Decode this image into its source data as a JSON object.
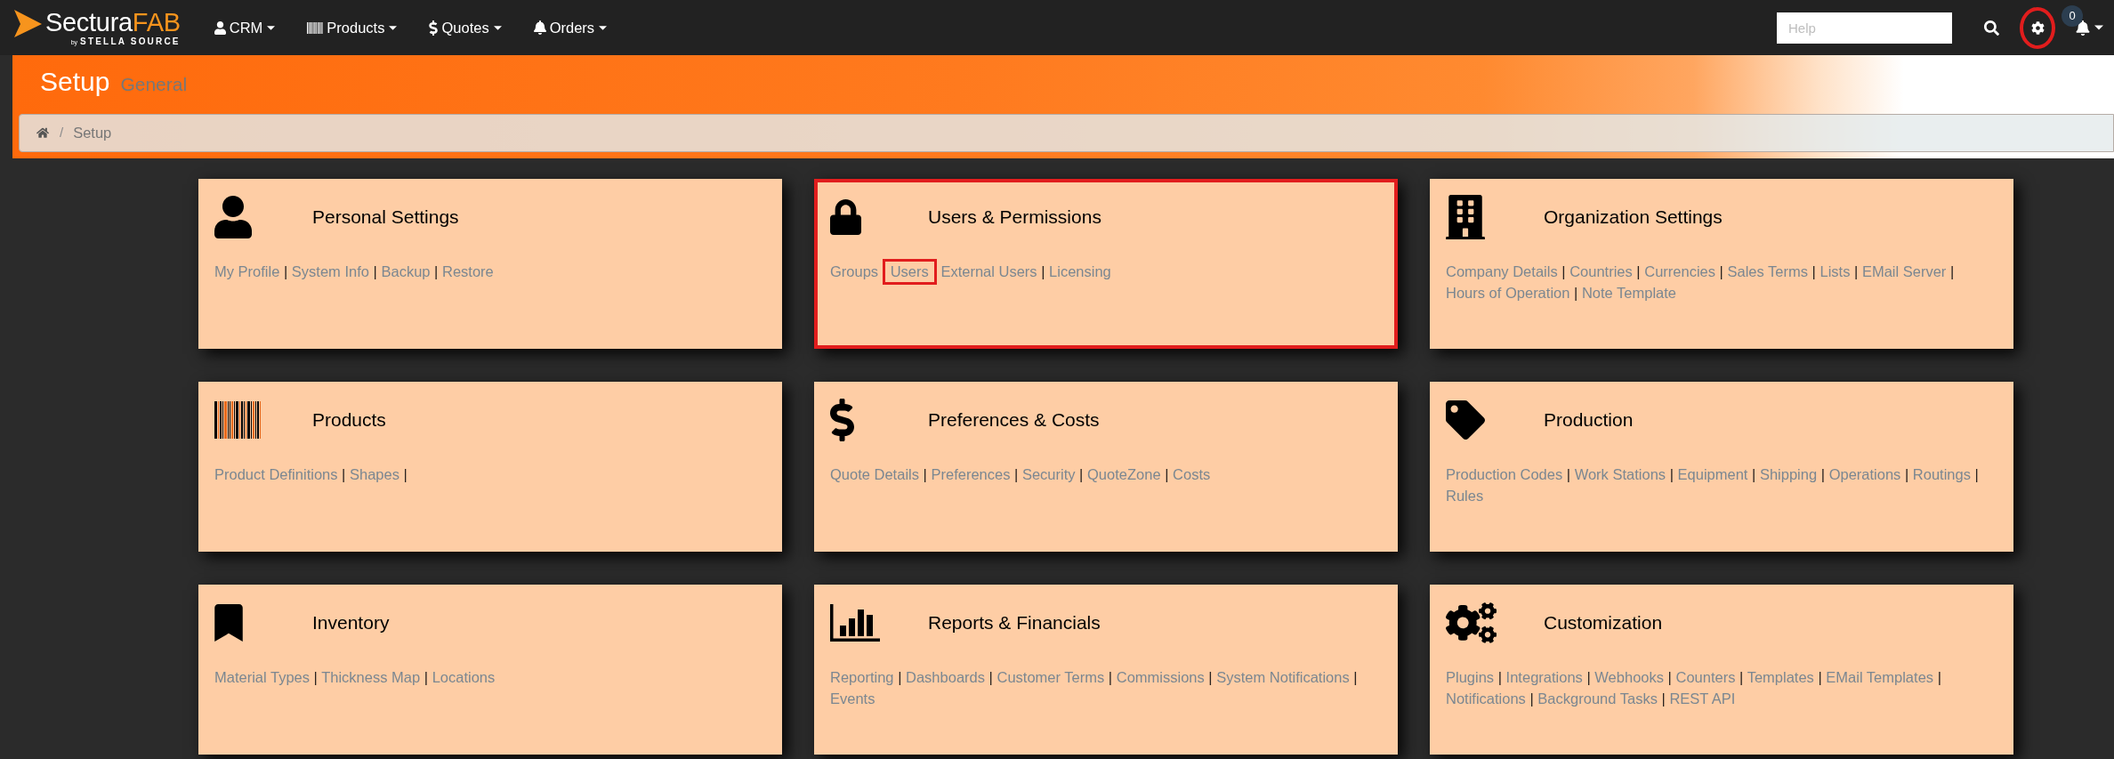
{
  "navbar": {
    "logo": {
      "name": "Sectura",
      "accent": "FAB",
      "tagline_prefix": "by",
      "tagline": "STELLA SOURCE"
    },
    "menus": [
      {
        "label": "CRM"
      },
      {
        "label": "Products"
      },
      {
        "label": "Quotes"
      },
      {
        "label": "Orders"
      }
    ],
    "help_search": {
      "placeholder": "Help"
    },
    "settings": {
      "highlighted": true
    },
    "notifications": {
      "count": "0"
    }
  },
  "page_header": {
    "title": "Setup",
    "subtitle": "General"
  },
  "breadcrumb": {
    "separator": "/",
    "items": [
      {
        "label": "Setup"
      }
    ]
  },
  "sections": [
    {
      "title": "Personal Settings",
      "highlighted": false,
      "links": [
        {
          "label": "My Profile",
          "highlighted": false,
          "separator": "|"
        },
        {
          "label": "System Info",
          "highlighted": false,
          "separator": "|"
        },
        {
          "label": "Backup",
          "highlighted": false,
          "separator": "|"
        },
        {
          "label": "Restore",
          "highlighted": false
        }
      ]
    },
    {
      "title": "Users & Permissions",
      "highlighted": true,
      "links": [
        {
          "label": "Groups",
          "highlighted": false
        },
        {
          "label": "Users",
          "highlighted": true
        },
        {
          "label": "External Users",
          "highlighted": false,
          "separator": "|"
        },
        {
          "label": "Licensing",
          "highlighted": false
        }
      ]
    },
    {
      "title": "Organization Settings",
      "highlighted": false,
      "links": [
        {
          "label": "Company Details",
          "highlighted": false,
          "separator": "|"
        },
        {
          "label": "Countries",
          "highlighted": false,
          "separator": "|"
        },
        {
          "label": "Currencies",
          "highlighted": false,
          "separator": "|"
        },
        {
          "label": "Sales Terms",
          "highlighted": false,
          "separator": "|"
        },
        {
          "label": "Lists",
          "highlighted": false,
          "separator": "|"
        },
        {
          "label": "EMail Server",
          "highlighted": false,
          "separator": "|"
        },
        {
          "label": "Hours of Operation",
          "highlighted": false,
          "separator": "|"
        },
        {
          "label": "Note Template",
          "highlighted": false
        }
      ]
    },
    {
      "title": "Products",
      "highlighted": false,
      "links": [
        {
          "label": "Product Definitions",
          "highlighted": false,
          "separator": "|"
        },
        {
          "label": "Shapes",
          "highlighted": false,
          "separator": "|"
        }
      ]
    },
    {
      "title": "Preferences & Costs",
      "highlighted": false,
      "links": [
        {
          "label": "Quote Details",
          "highlighted": false,
          "separator": "|"
        },
        {
          "label": "Preferences",
          "highlighted": false,
          "separator": "|"
        },
        {
          "label": "Security",
          "highlighted": false,
          "separator": "|"
        },
        {
          "label": "QuoteZone",
          "highlighted": false,
          "separator": "|"
        },
        {
          "label": "Costs",
          "highlighted": false
        }
      ]
    },
    {
      "title": "Production",
      "highlighted": false,
      "links": [
        {
          "label": "Production Codes",
          "highlighted": false,
          "separator": "|"
        },
        {
          "label": "Work Stations",
          "highlighted": false,
          "separator": "|"
        },
        {
          "label": "Equipment",
          "highlighted": false,
          "separator": "|"
        },
        {
          "label": "Shipping",
          "highlighted": false,
          "separator": "|"
        },
        {
          "label": "Operations",
          "highlighted": false,
          "separator": "|"
        },
        {
          "label": "Routings",
          "highlighted": false,
          "separator": "|"
        },
        {
          "label": "Rules",
          "highlighted": false
        }
      ]
    },
    {
      "title": "Inventory",
      "highlighted": false,
      "links": [
        {
          "label": "Material Types",
          "highlighted": false,
          "separator": "|"
        },
        {
          "label": "Thickness Map",
          "highlighted": false,
          "separator": "|"
        },
        {
          "label": "Locations",
          "highlighted": false
        }
      ]
    },
    {
      "title": "Reports & Financials",
      "highlighted": false,
      "links": [
        {
          "label": "Reporting",
          "highlighted": false,
          "separator": "|"
        },
        {
          "label": "Dashboards",
          "highlighted": false,
          "separator": "|"
        },
        {
          "label": "Customer Terms",
          "highlighted": false,
          "separator": "|"
        },
        {
          "label": "Commissions",
          "highlighted": false,
          "separator": "|"
        },
        {
          "label": "System Notifications",
          "highlighted": false,
          "separator": "|"
        },
        {
          "label": "Events",
          "highlighted": false
        }
      ]
    },
    {
      "title": "Customization",
      "highlighted": false,
      "links": [
        {
          "label": "Plugins",
          "highlighted": false,
          "separator": "|"
        },
        {
          "label": "Integrations",
          "highlighted": false,
          "separator": "|"
        },
        {
          "label": "Webhooks",
          "highlighted": false,
          "separator": "|"
        },
        {
          "label": "Counters",
          "highlighted": false,
          "separator": "|"
        },
        {
          "label": "Templates",
          "highlighted": false,
          "separator": "|"
        },
        {
          "label": "EMail Templates",
          "highlighted": false,
          "separator": "|"
        },
        {
          "label": "Notifications",
          "highlighted": false,
          "separator": "|"
        },
        {
          "label": "Background Tasks",
          "highlighted": false,
          "separator": "|"
        },
        {
          "label": "REST API",
          "highlighted": false
        }
      ]
    }
  ]
}
